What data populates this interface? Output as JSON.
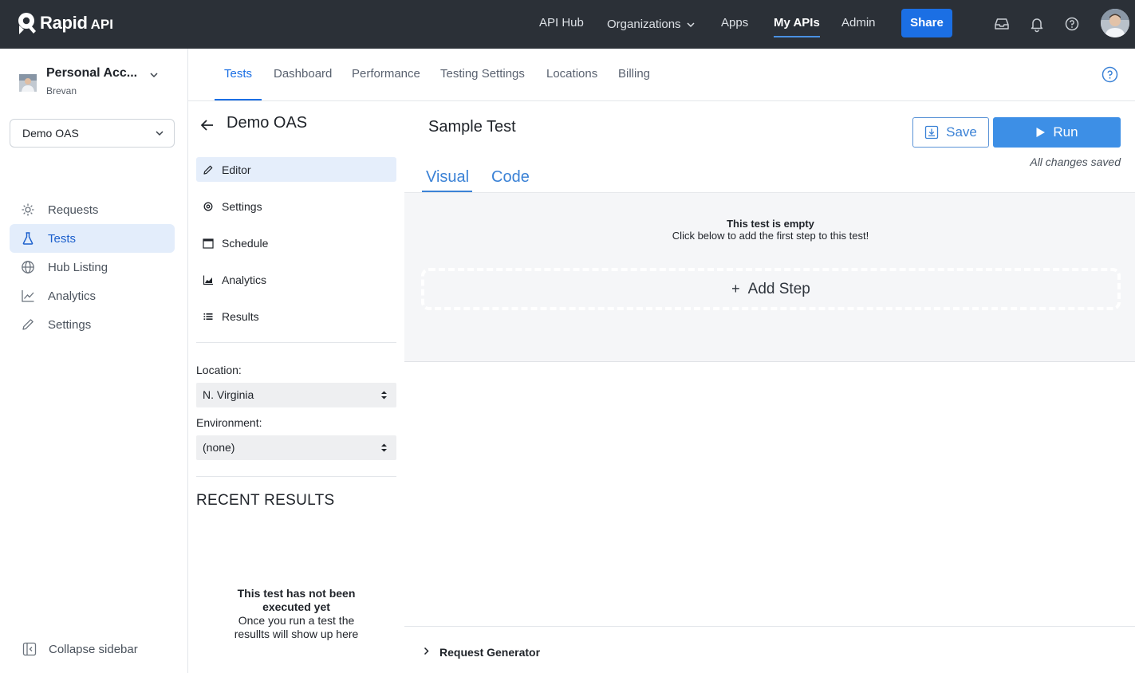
{
  "brand": {
    "name": "Rapid",
    "suffix": "API"
  },
  "topnav": {
    "items": [
      "API Hub",
      "Organizations",
      "Apps",
      "My APIs",
      "Admin"
    ],
    "active": "My APIs",
    "share_label": "Share"
  },
  "account": {
    "name": "Personal Acc...",
    "username": "Brevan"
  },
  "api_selector": {
    "value": "Demo OAS"
  },
  "sidebar": {
    "items": [
      {
        "label": "Requests",
        "icon": "requests-icon"
      },
      {
        "label": "Tests",
        "icon": "flask-icon"
      },
      {
        "label": "Hub Listing",
        "icon": "globe-icon"
      },
      {
        "label": "Analytics",
        "icon": "analytics-icon"
      },
      {
        "label": "Settings",
        "icon": "pencil-icon"
      }
    ],
    "active": "Tests",
    "collapse_label": "Collapse sidebar"
  },
  "page_tabs": {
    "items": [
      "Tests",
      "Dashboard",
      "Performance",
      "Testing Settings",
      "Locations",
      "Billing"
    ],
    "active": "Tests"
  },
  "test_panel": {
    "title": "Demo OAS",
    "nav": [
      "Editor",
      "Settings",
      "Schedule",
      "Analytics",
      "Results"
    ],
    "active": "Editor",
    "location_label": "Location:",
    "location_value": "N. Virginia",
    "environment_label": "Environment:",
    "environment_value": "(none)",
    "recent_results_heading": "RECENT RESULTS",
    "not_run_title": "This test has not been executed yet",
    "not_run_body": "Once you run a test the resullts will show up here"
  },
  "editor": {
    "test_name": "Sample Test",
    "save_label": "Save",
    "run_label": "Run",
    "status": "All changes saved",
    "tabs": [
      "Visual",
      "Code"
    ],
    "active_tab": "Visual",
    "empty_title": "This test is empty",
    "empty_subtitle": "Click below to add the first step to this test!",
    "add_step_label": "Add Step",
    "request_generator_label": "Request Generator"
  },
  "colors": {
    "topbar": "#2b3037",
    "accent": "#1b6fe4",
    "run_button": "#3d8fe6",
    "active_bg": "#e3edfb"
  }
}
